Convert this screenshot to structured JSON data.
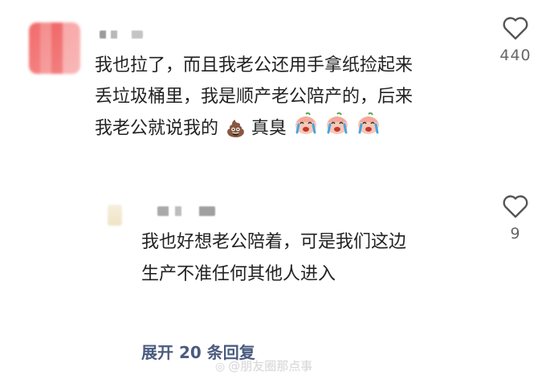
{
  "comment": {
    "line1": "我也拉了，而且我老公还用手拿纸捡起来",
    "line2": "丢垃圾桶里，我是顺产老公陪产的，后来",
    "line3": "我老公就说我的",
    "line3_after": "真臭",
    "likes": "440",
    "icons": [
      "poop-emoji",
      "crying-face-emoji",
      "crying-face-emoji",
      "crying-face-emoji"
    ]
  },
  "reply": {
    "line1": "我也好想老公陪着，可是我们这边",
    "line2": "生产不准任何其他人进入",
    "likes": "9"
  },
  "expand_replies_label": "展开 20 条回复",
  "watermark": "@朋友圈那点事",
  "colors": {
    "expand_link": "#4a5b7f",
    "like_count": "#666666",
    "text": "#222222"
  }
}
